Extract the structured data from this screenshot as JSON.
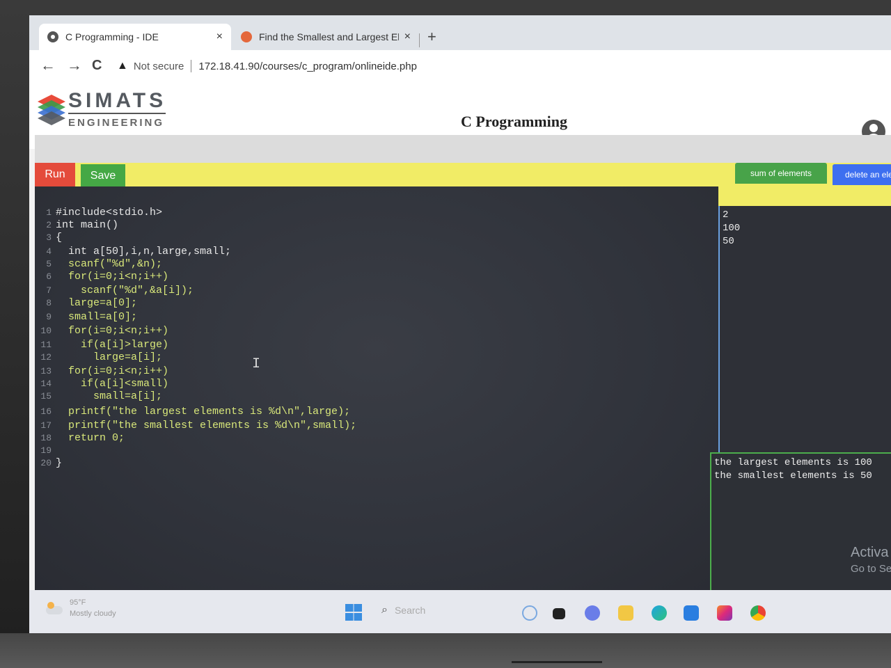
{
  "browser": {
    "tabs": [
      {
        "title": "C Programming - IDE",
        "close": "×"
      },
      {
        "title": "Find the Smallest and Largest Ele",
        "close": "×"
      }
    ],
    "new_tab": "+",
    "security": "Not secure",
    "url": "172.18.41.90/courses/c_program/onlineide.php",
    "nav": {
      "back": "←",
      "forward": "→",
      "reload": "C"
    }
  },
  "header": {
    "logo_top": "SIMATS",
    "logo_bottom": "ENGINEERING",
    "title": "C Programming"
  },
  "toolbar": {
    "run_label": "Run",
    "save_label": "Save",
    "sum_label": "sum of elements",
    "delete_label": "delete an ele"
  },
  "editor": {
    "lines": [
      {
        "n": "1",
        "text": "#include<stdio.h>",
        "indent": 0
      },
      {
        "n": "2",
        "text": "int main()",
        "indent": 0
      },
      {
        "n": "3",
        "text": "{",
        "indent": 0
      },
      {
        "n": "4",
        "text": "int a[50],i,n,large,small;",
        "indent": 1
      },
      {
        "n": "5",
        "text": "scanf(\"%d\",&n);",
        "indent": 1
      },
      {
        "n": "6",
        "text": "for(i=0;i<n;i++)",
        "indent": 1
      },
      {
        "n": "7",
        "text": "scanf(\"%d\",&a[i]);",
        "indent": 2
      },
      {
        "n": "8",
        "text": "large=a[0];",
        "indent": 1
      },
      {
        "n": "9",
        "text": "small=a[0];",
        "indent": 1
      },
      {
        "n": "10",
        "text": "for(i=0;i<n;i++)",
        "indent": 1
      },
      {
        "n": "11",
        "text": "if(a[i]>large)",
        "indent": 2
      },
      {
        "n": "12",
        "text": "large=a[i];",
        "indent": 3
      },
      {
        "n": "13",
        "text": "for(i=0;i<n;i++)",
        "indent": 1
      },
      {
        "n": "14",
        "text": "if(a[i]<small)",
        "indent": 2
      },
      {
        "n": "15",
        "text": "small=a[i];",
        "indent": 3
      },
      {
        "n": "16",
        "text": "printf(\"the largest elements is %d\\n\",large);",
        "indent": 1
      },
      {
        "n": "17",
        "text": "printf(\"the smallest elements is %d\\n\",small);",
        "indent": 1
      },
      {
        "n": "18",
        "text": "return 0;",
        "indent": 1
      },
      {
        "n": "19",
        "text": "",
        "indent": 0
      },
      {
        "n": "20",
        "text": "}",
        "indent": 0
      }
    ],
    "cursor": "I"
  },
  "input": [
    "2",
    "100",
    "50"
  ],
  "output": [
    "the largest elements is 100",
    "the smallest elements is 50"
  ],
  "watermark": {
    "line1": "Activa",
    "line2": "Go to Se"
  },
  "taskbar": {
    "temp": "95°F",
    "weather": "Mostly cloudy",
    "search": "Search",
    "search_icon": "search-icon"
  }
}
